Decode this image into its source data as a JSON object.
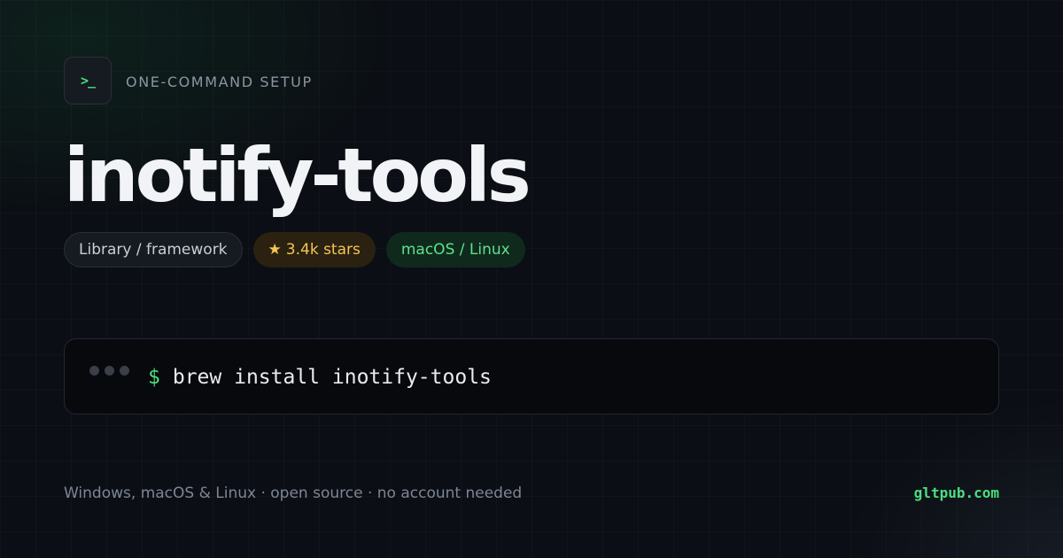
{
  "header": {
    "icon_name": "terminal-prompt-icon",
    "icon_glyph": ">_",
    "eyebrow": "ONE-COMMAND SETUP"
  },
  "title": "inotify-tools",
  "badges": {
    "type": "Library / framework",
    "stars_icon": "★",
    "stars": "3.4k stars",
    "platform": "macOS / Linux"
  },
  "terminal": {
    "prompt": "$",
    "command": "brew install inotify-tools"
  },
  "footer": {
    "note": "Windows, macOS & Linux · open source · no account needed",
    "domain": "gltpub.com"
  },
  "colors": {
    "background": "#0b0e14",
    "accent_green": "#4ade80",
    "star_yellow": "#f6c453",
    "title_text": "#f1f3f6"
  }
}
